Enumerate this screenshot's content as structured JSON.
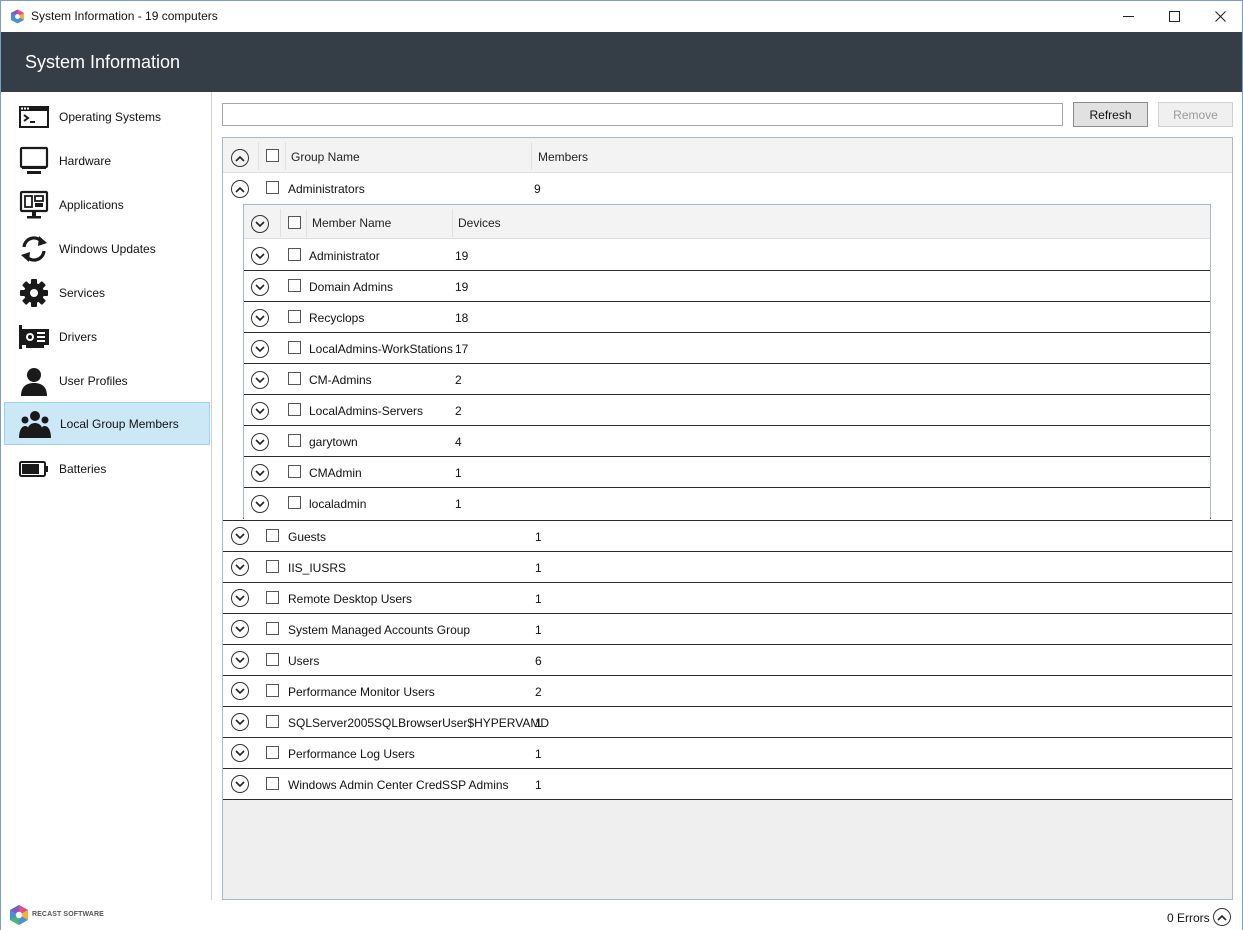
{
  "window": {
    "title": "System Information - 19 computers"
  },
  "header": {
    "title": "System Information"
  },
  "sidebar": {
    "items": [
      {
        "label": "Operating Systems",
        "icon": "terminal-icon"
      },
      {
        "label": "Hardware",
        "icon": "monitor-icon"
      },
      {
        "label": "Applications",
        "icon": "applications-icon"
      },
      {
        "label": "Windows Updates",
        "icon": "refresh-icon"
      },
      {
        "label": "Services",
        "icon": "gear-icon"
      },
      {
        "label": "Drivers",
        "icon": "driver-card-icon"
      },
      {
        "label": "User Profiles",
        "icon": "user-icon"
      },
      {
        "label": "Local Group Members",
        "icon": "group-icon",
        "active": true
      },
      {
        "label": "Batteries",
        "icon": "battery-icon"
      }
    ]
  },
  "toolbar": {
    "search_value": "",
    "refresh_label": "Refresh",
    "remove_label": "Remove"
  },
  "grid": {
    "columns": {
      "group_name": "Group Name",
      "members": "Members"
    },
    "expanded_group": {
      "name": "Administrators",
      "members": "9"
    },
    "inner_columns": {
      "member_name": "Member Name",
      "devices": "Devices"
    },
    "members": [
      {
        "name": "Administrator",
        "devices": "19"
      },
      {
        "name": "Domain Admins",
        "devices": "19"
      },
      {
        "name": "Recyclops",
        "devices": "18"
      },
      {
        "name": "LocalAdmins-WorkStations",
        "devices": "17"
      },
      {
        "name": "CM-Admins",
        "devices": "2"
      },
      {
        "name": "LocalAdmins-Servers",
        "devices": "2"
      },
      {
        "name": "garytown",
        "devices": "4"
      },
      {
        "name": "CMAdmin",
        "devices": "1"
      },
      {
        "name": "localadmin",
        "devices": "1"
      }
    ],
    "groups": [
      {
        "name": "Guests",
        "members": "1"
      },
      {
        "name": "IIS_IUSRS",
        "members": "1"
      },
      {
        "name": "Remote Desktop Users",
        "members": "1"
      },
      {
        "name": "System Managed Accounts Group",
        "members": "1"
      },
      {
        "name": "Users",
        "members": "6"
      },
      {
        "name": "Performance Monitor Users",
        "members": "2"
      },
      {
        "name": "SQLServer2005SQLBrowserUser$HYPERVAMD",
        "members": "1"
      },
      {
        "name": "Performance Log Users",
        "members": "1"
      },
      {
        "name": "Windows Admin Center CredSSP Admins",
        "members": "1"
      }
    ]
  },
  "footer": {
    "brand": "RECAST SOFTWARE",
    "errors": "0 Errors"
  },
  "colors": {
    "header_bg": "#353d47",
    "active_nav": "#cce8f7",
    "border_accent": "#a9b7c6"
  }
}
